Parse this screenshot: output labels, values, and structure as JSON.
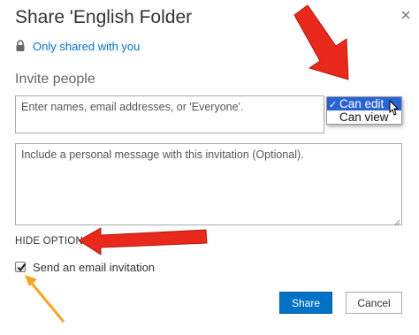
{
  "dialog": {
    "title": "Share 'English Folder",
    "shared_status": "Only shared with you",
    "icons": {
      "close": "close-icon",
      "lock": "lock-icon",
      "check": "check-icon"
    }
  },
  "invite": {
    "label": "Invite people",
    "people_placeholder": "Enter names, email addresses, or 'Everyone'.",
    "permission": {
      "options": [
        {
          "label": "Can edit",
          "selected": true
        },
        {
          "label": "Can view",
          "selected": false
        }
      ]
    },
    "message_placeholder": "Include a personal message with this invitation (Optional)."
  },
  "options": {
    "toggle_label": "HIDE OPTIONS",
    "send_email_label": "Send an email invitation",
    "send_email_checked": true
  },
  "buttons": {
    "share": "Share",
    "cancel": "Cancel"
  },
  "colors": {
    "primary": "#0072c6",
    "selection": "#2a63d6",
    "annotation_red": "#e8291c",
    "annotation_orange": "#f5a623"
  }
}
